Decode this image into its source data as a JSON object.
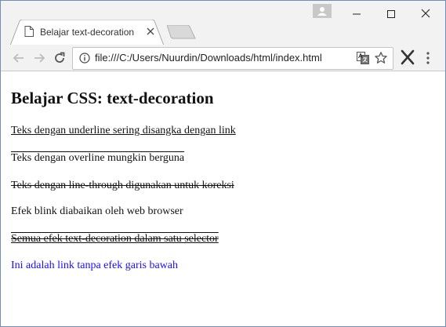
{
  "browser": {
    "tab": {
      "title": "Belajar text-decoration"
    },
    "address_bar": {
      "url": "file:///C:/Users/Nuurdin/Downloads/html/index.html"
    }
  },
  "page": {
    "heading": "Belajar CSS: text-decoration",
    "lines": [
      "Teks dengan underline sering disangka dengan link",
      "Teks dengan overline mungkin berguna",
      "Teks dengan line-through digunakan untuk koreksi",
      "Efek blink diabaikan oleh web browser",
      "Semua efek text-decoration dalam satu selector"
    ],
    "link": "Ini adalah link tanpa efek garis bawah"
  },
  "colors": {
    "chrome": "#f2f2f2",
    "link": "#1a0dff",
    "window_border": "#6f8fb8"
  },
  "icons": [
    "page-icon",
    "close-icon",
    "user-icon",
    "minimize-icon",
    "maximize-icon",
    "close-window-icon",
    "back-icon",
    "forward-icon",
    "reload-icon",
    "info-icon",
    "translate-icon",
    "star-icon",
    "extension-icon",
    "menu-icon"
  ]
}
